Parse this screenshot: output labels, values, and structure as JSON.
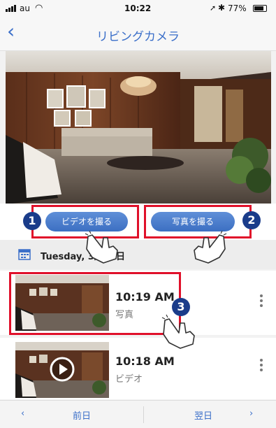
{
  "status_bar": {
    "carrier": "au",
    "time": "10:22",
    "battery": "77%"
  },
  "nav": {
    "title": "リビングカメラ",
    "back_icon": "chevron-left-icon"
  },
  "actions": {
    "video_label": "ビデオを撮る",
    "photo_label": "写真を撮る",
    "markers": [
      "1",
      "2",
      "3"
    ]
  },
  "date_header": {
    "label": "Tuesday, 3月20日",
    "icon": "calendar-icon"
  },
  "recordings": [
    {
      "time": "10:19 AM",
      "type": "写真"
    },
    {
      "time": "10:18 AM",
      "type": "ビデオ"
    }
  ],
  "footer": {
    "prev_label": "前日",
    "next_label": "翌日"
  },
  "colors": {
    "accent": "#3b6fc9",
    "highlight": "#e0102a",
    "marker": "#1a3c8a"
  }
}
